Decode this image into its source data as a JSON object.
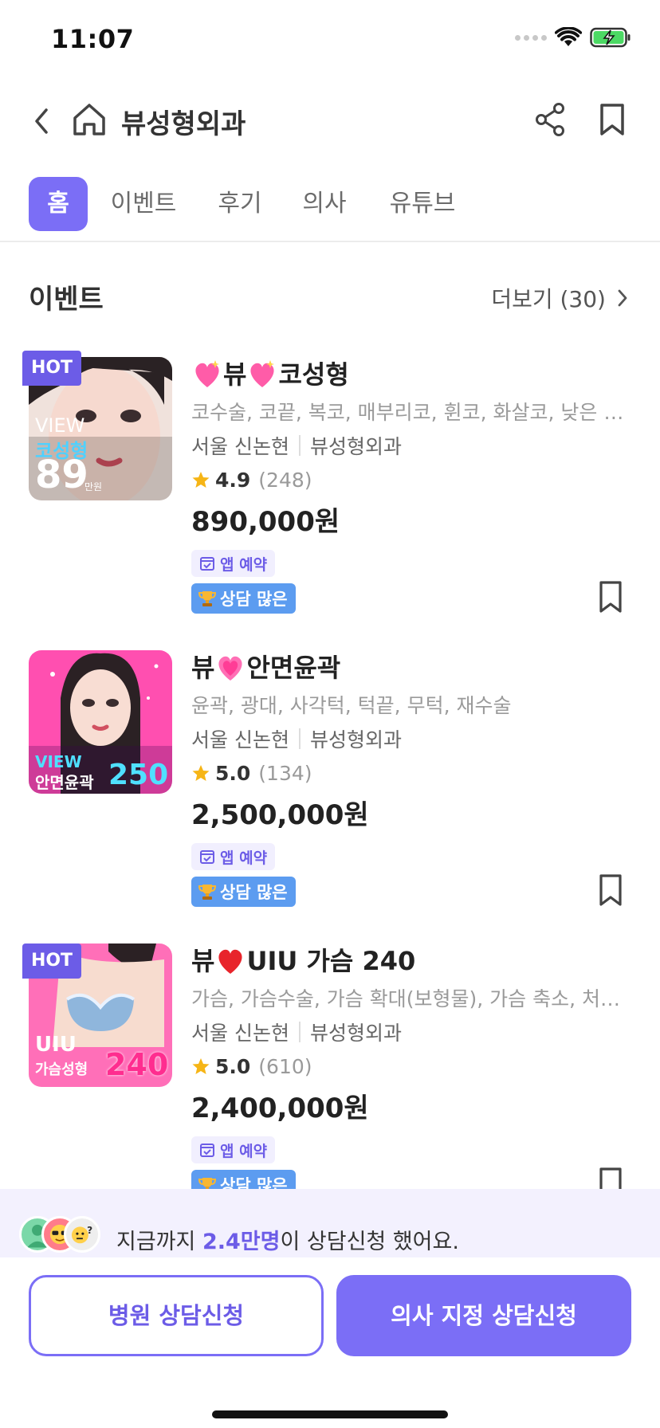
{
  "status_bar": {
    "time": "11:07"
  },
  "header": {
    "title": "뷰성형외과"
  },
  "tabs": [
    {
      "label": "홈",
      "active": true
    },
    {
      "label": "이벤트",
      "active": false
    },
    {
      "label": "후기",
      "active": false
    },
    {
      "label": "의사",
      "active": false
    },
    {
      "label": "유튜브",
      "active": false
    }
  ],
  "events_section": {
    "title": "이벤트",
    "more_label": "더보기 (30)"
  },
  "events": [
    {
      "hot_label": "HOT",
      "title_prefix": "",
      "heart_icon": "sparkling-heart-icon",
      "title_mid": "뷰",
      "title_suffix": "코성형",
      "thumb_text": [
        "VIEW",
        "코성형",
        "89",
        "만원"
      ],
      "desc": "코수술, 코끝, 복코, 매부리코, 휜코, 화살코, 낮은 코...",
      "location": "서울 신논현",
      "hospital": "뷰성형외과",
      "rating": "4.9",
      "review_count": "(248)",
      "price": "890,000원",
      "app_badge": "앱 예약",
      "consult_badge": "상담 많은"
    },
    {
      "hot_label": "",
      "title_prefix": "뷰",
      "heart_icon": "growing-heart-icon",
      "title_mid": "",
      "title_suffix": "안면윤곽",
      "thumb_text": [
        "VIEW",
        "안면윤곽",
        "250"
      ],
      "desc": "윤곽, 광대, 사각턱, 턱끝, 무턱, 재수술",
      "location": "서울 신논현",
      "hospital": "뷰성형외과",
      "rating": "5.0",
      "review_count": "(134)",
      "price": "2,500,000원",
      "app_badge": "앱 예약",
      "consult_badge": "상담 많은"
    },
    {
      "hot_label": "HOT",
      "title_prefix": "뷰",
      "heart_icon": "red-heart-icon",
      "title_mid": "",
      "title_suffix": "UIU 가슴 240",
      "thumb_text": [
        "UIU",
        "가슴성형",
        "240"
      ],
      "desc": "가슴, 가슴수술, 가슴 확대(보형물), 가슴 축소, 처진…",
      "location": "서울 신논현",
      "hospital": "뷰성형외과",
      "rating": "5.0",
      "review_count": "(610)",
      "price": "2,400,000원",
      "app_badge": "앱 예약",
      "consult_badge": "상담 많은"
    }
  ],
  "consult_banner": {
    "prefix": "지금까지 ",
    "highlight": "2.4만명",
    "suffix": "이 상담신청 했어요."
  },
  "buttons": {
    "hospital_consult": "병원 상담신청",
    "doctor_consult": "의사 지정 상담신청"
  },
  "colors": {
    "accent": "#7b6ef6",
    "hot_badge": "#6c5ce7",
    "consult_badge": "#5c9cf0",
    "star": "#f6b516"
  }
}
